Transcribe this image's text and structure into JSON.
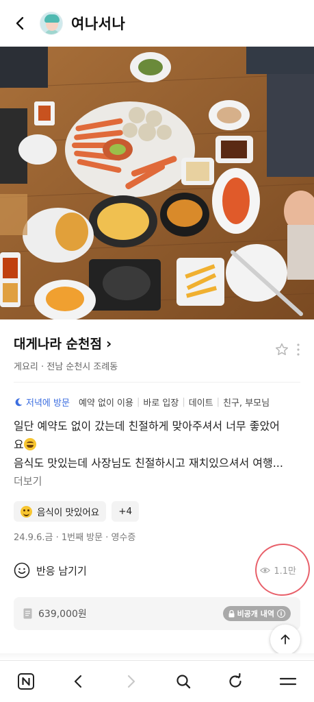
{
  "header": {
    "nickname": "여나서나"
  },
  "place": {
    "name": "대게나라 순천점",
    "chevron": "›",
    "category": "게요리",
    "dot": "·",
    "location": "전남 순천시 조례동"
  },
  "tags": {
    "visit_time": "저녁에 방문",
    "items": [
      "예약 없이 이용",
      "바로 입장",
      "데이트",
      "친구, 부모님"
    ]
  },
  "review": {
    "line1": "일단 예약도 없이 갔는데 친절하게 맞아주셔서 너무 좋았어",
    "line2": "요",
    "line3": "음식도 맛있는데 사장님도 친절하시고 재치있으셔서 여행...",
    "more": "더보기"
  },
  "chips": {
    "main": "음식이 맛있어요",
    "extra": "+4"
  },
  "meta": "24.9.6.금 · 1번째 방문 · 영수증",
  "reaction": {
    "label": "반응 남기기",
    "views": "1.1만"
  },
  "receipt": {
    "price": "639,000원",
    "private_label": "비공개 내역",
    "info": "i"
  },
  "icons": [
    "chevron-left-icon",
    "avatar",
    "star-icon",
    "more-vertical-icon",
    "moon-icon",
    "grin-emoji-icon",
    "smile-emoji-icon",
    "smiley-face-icon",
    "eye-icon",
    "receipt-icon",
    "lock-icon",
    "info-icon",
    "arrow-up-icon",
    "naver-n-icon",
    "back-icon",
    "forward-icon",
    "search-icon",
    "refresh-icon",
    "menu-icon"
  ],
  "colors": {
    "accent_blue": "#3c6ee0",
    "annotation_red": "#e8606a",
    "chip_bg": "#f3f3f3",
    "emoji_yellow": "#f7c531"
  }
}
